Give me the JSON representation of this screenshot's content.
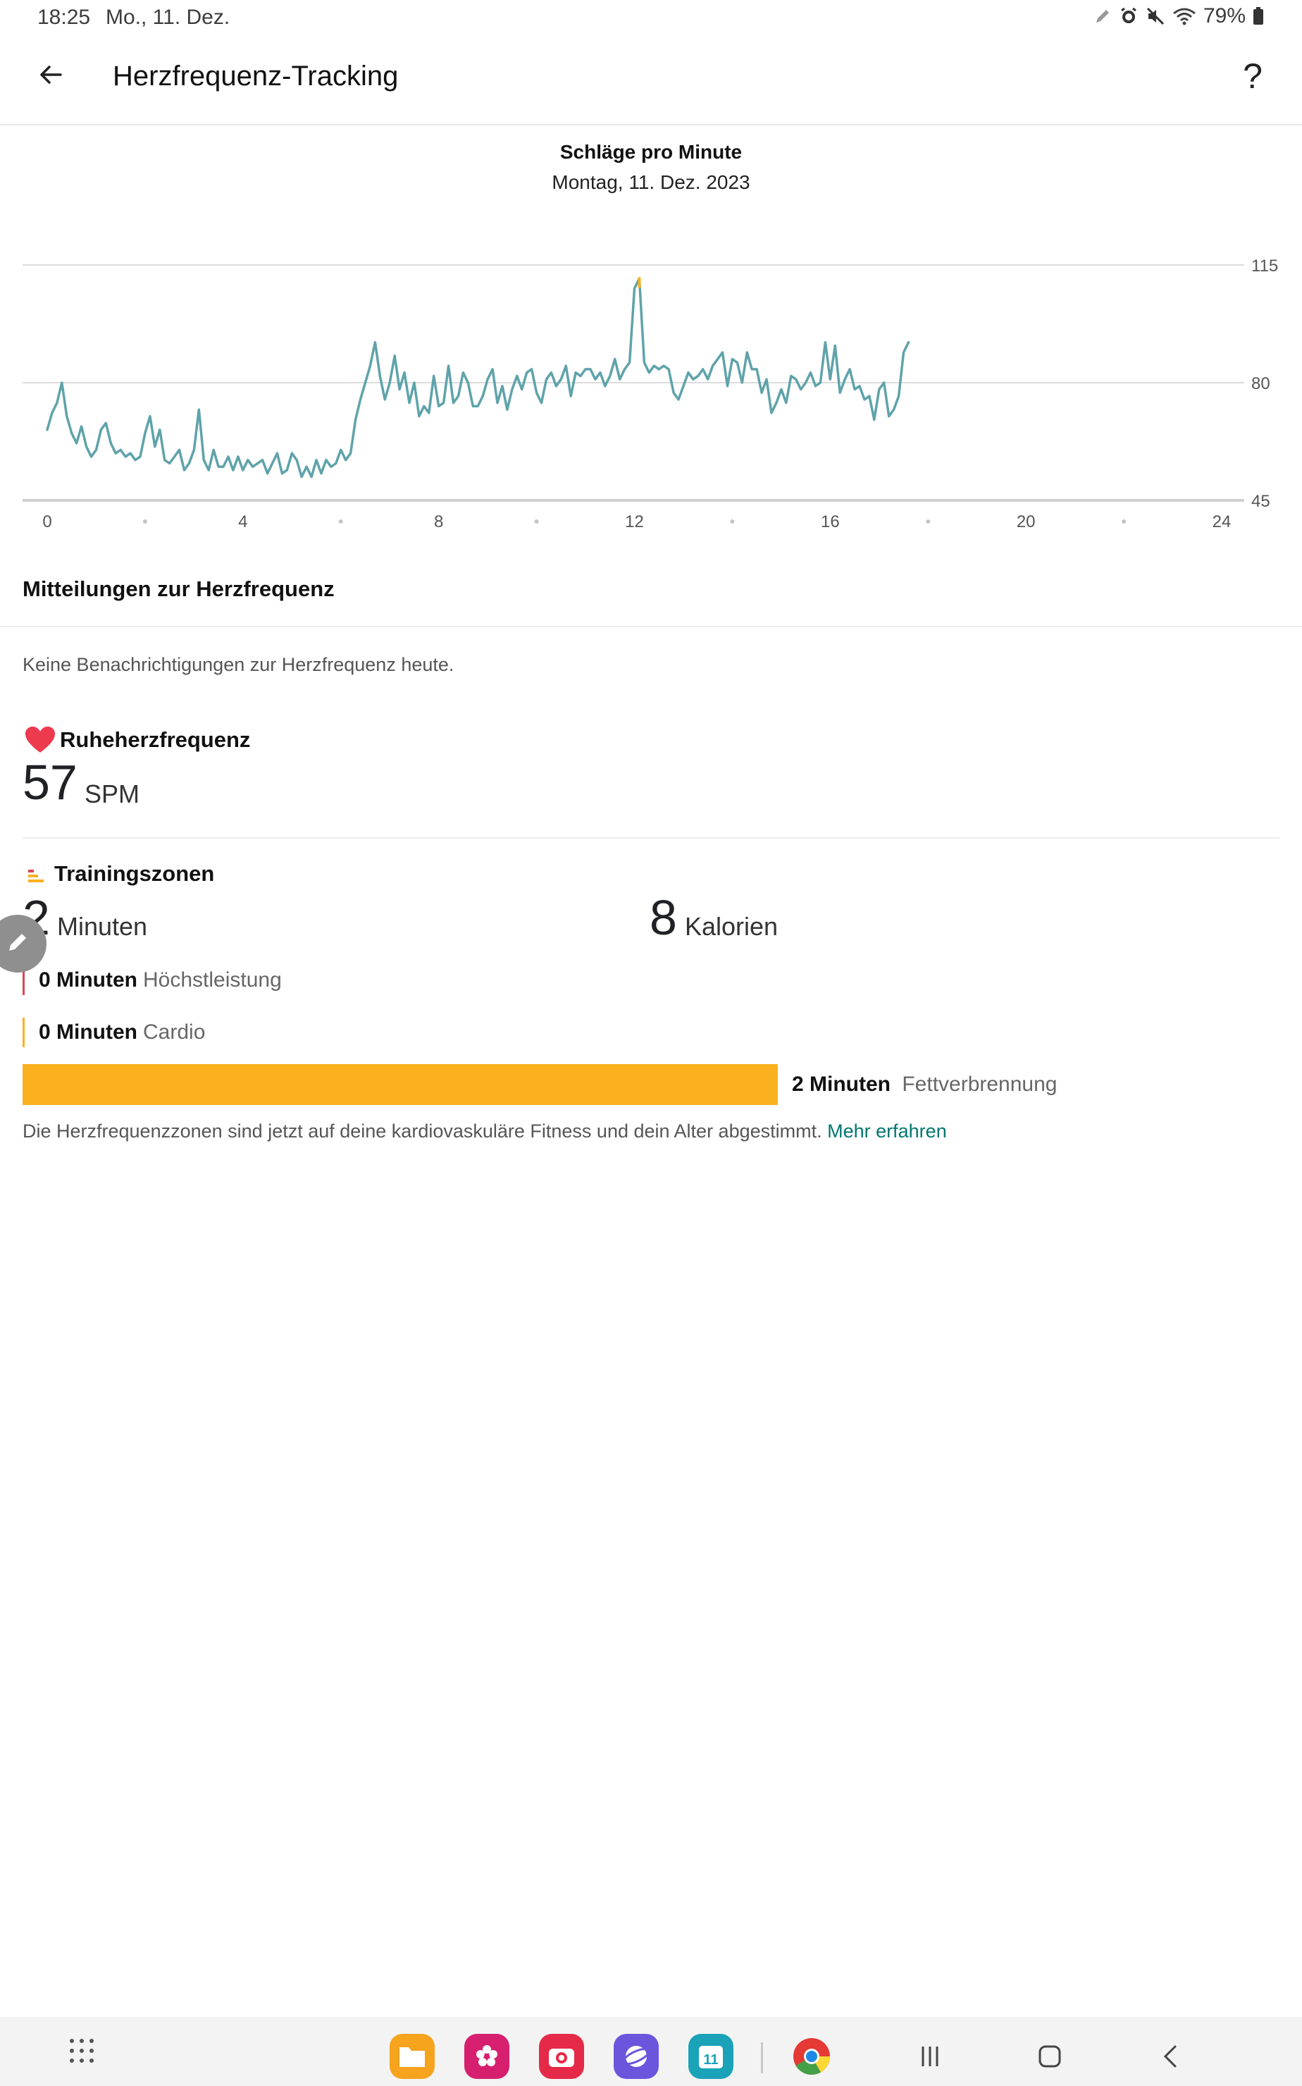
{
  "status_bar": {
    "time": "18:25",
    "date": "Mo., 11. Dez.",
    "battery": "79%",
    "icons": [
      "pen-icon",
      "alarm-icon",
      "mute-icon",
      "wifi-icon",
      "battery-icon"
    ]
  },
  "header": {
    "title": "Herzfrequenz-Tracking",
    "help_label": "?"
  },
  "chart": {
    "title": "Schläge pro Minute",
    "subtitle": "Montag, 11. Dez. 2023"
  },
  "chart_data": {
    "type": "line",
    "title": "Schläge pro Minute",
    "subtitle": "Montag, 11. Dez. 2023",
    "x_ticks": [
      "0",
      "4",
      "8",
      "12",
      "16",
      "20",
      "24"
    ],
    "y_ticks": [
      "115",
      "80",
      "45"
    ],
    "xlim": [
      0,
      24
    ],
    "ylim": [
      45,
      115
    ],
    "grid": true,
    "line_color": "#5fa3aa",
    "peak_color": "#f4b223",
    "x": [
      0.0,
      0.1,
      0.2,
      0.3,
      0.4,
      0.5,
      0.6,
      0.7,
      0.8,
      0.9,
      1.0,
      1.1,
      1.2,
      1.3,
      1.4,
      1.5,
      1.6,
      1.7,
      1.8,
      1.9,
      2.0,
      2.1,
      2.2,
      2.3,
      2.4,
      2.5,
      2.6,
      2.7,
      2.8,
      2.9,
      3.0,
      3.1,
      3.2,
      3.3,
      3.4,
      3.5,
      3.6,
      3.7,
      3.8,
      3.9,
      4.0,
      4.1,
      4.2,
      4.3,
      4.4,
      4.5,
      4.6,
      4.7,
      4.8,
      4.9,
      5.0,
      5.1,
      5.2,
      5.3,
      5.4,
      5.5,
      5.6,
      5.7,
      5.8,
      5.9,
      6.0,
      6.1,
      6.2,
      6.3,
      6.4,
      6.5,
      6.6,
      6.7,
      6.8,
      6.9,
      7.0,
      7.1,
      7.2,
      7.3,
      7.4,
      7.5,
      7.6,
      7.7,
      7.8,
      7.9,
      8.0,
      8.1,
      8.2,
      8.3,
      8.4,
      8.5,
      8.6,
      8.7,
      8.8,
      8.9,
      9.0,
      9.1,
      9.2,
      9.3,
      9.4,
      9.5,
      9.6,
      9.7,
      9.8,
      9.9,
      10.0,
      10.1,
      10.2,
      10.3,
      10.4,
      10.5,
      10.6,
      10.7,
      10.8,
      10.9,
      11.0,
      11.1,
      11.2,
      11.3,
      11.4,
      11.5,
      11.6,
      11.7,
      11.8,
      11.9,
      12.0,
      12.1,
      12.2,
      12.3,
      12.4,
      12.5,
      12.6,
      12.7,
      12.8,
      12.9,
      13.0,
      13.1,
      13.2,
      13.3,
      13.4,
      13.5,
      13.6,
      13.7,
      13.8,
      13.9,
      14.0,
      14.1,
      14.2,
      14.3,
      14.4,
      14.5,
      14.6,
      14.7,
      14.8,
      14.9,
      15.0,
      15.1,
      15.2,
      15.3,
      15.4,
      15.5,
      15.6,
      15.7,
      15.8,
      15.9,
      16.0,
      16.1,
      16.2,
      16.3,
      16.4,
      16.5,
      16.6,
      16.7,
      16.8,
      16.9,
      17.0,
      17.1,
      17.2,
      17.3,
      17.4,
      17.5,
      17.6,
      17.7,
      17.8,
      17.9,
      18.0,
      18.1,
      18.2
    ],
    "y": [
      66,
      71,
      74,
      80,
      70,
      65,
      62,
      67,
      61,
      58,
      60,
      66,
      68,
      62,
      59,
      60,
      58,
      59,
      57,
      58,
      65,
      70,
      61,
      66,
      57,
      56,
      58,
      60,
      54,
      56,
      60,
      72,
      57,
      54,
      60,
      55,
      55,
      58,
      54,
      58,
      54,
      57,
      55,
      56,
      57,
      53,
      56,
      59,
      53,
      54,
      59,
      57,
      52,
      55,
      52,
      57,
      53,
      57,
      55,
      56,
      60,
      57,
      59,
      69,
      75,
      80,
      85,
      92,
      82,
      75,
      80,
      88,
      78,
      83,
      74,
      80,
      70,
      73,
      71,
      82,
      73,
      74,
      85,
      74,
      76,
      83,
      80,
      73,
      73,
      76,
      81,
      84,
      74,
      79,
      72,
      78,
      82,
      78,
      83,
      84,
      77,
      74,
      81,
      83,
      79,
      81,
      85,
      76,
      83,
      82,
      84,
      84,
      81,
      83,
      79,
      82,
      87,
      81,
      84,
      86,
      108,
      111,
      86,
      83,
      85,
      84,
      85,
      84,
      77,
      75,
      79,
      83,
      81,
      82,
      84,
      81,
      85,
      87,
      89,
      79,
      87,
      86,
      80,
      89,
      84,
      84,
      77,
      81,
      71,
      74,
      78,
      74,
      82,
      81,
      78,
      80,
      83,
      79,
      80,
      92,
      81,
      91,
      77,
      81,
      84,
      78,
      79,
      75,
      76,
      69,
      78,
      80,
      70,
      72,
      76,
      89,
      92
    ]
  },
  "notifications": {
    "title": "Mitteilungen zur Herzfrequenz",
    "empty_text": "Keine Benachrichtigungen zur Herzfrequenz heute."
  },
  "resting": {
    "title": "Ruheherzfrequenz",
    "value": "57",
    "unit": "SPM"
  },
  "zones": {
    "title": "Trainingszonen",
    "minutes_value": "2",
    "minutes_unit": "Minuten",
    "calories_value": "8",
    "calories_unit": "Kalorien",
    "items": [
      {
        "strong": "0 Minuten",
        "label": "Höchstleistung",
        "color": "#e04457",
        "minutes": 0
      },
      {
        "strong": "0 Minuten",
        "label": "Cardio",
        "color": "#f4b223",
        "minutes": 0
      },
      {
        "strong": "2 Minuten",
        "label": "Fettverbrennung",
        "color": "#fbb01e",
        "minutes": 2
      }
    ],
    "info_text": "Die Herzfrequenzzonen sind jetzt auf deine kardiovaskuläre Fitness und dein Alter abgestimmt.",
    "info_link": "Mehr erfahren"
  },
  "nav_bar": {
    "apps": [
      "files-app-icon",
      "gallery-app-icon",
      "camera-app-icon",
      "internet-app-icon",
      "calendar-app-icon",
      "chrome-app-icon"
    ],
    "calendar_day": "11"
  }
}
